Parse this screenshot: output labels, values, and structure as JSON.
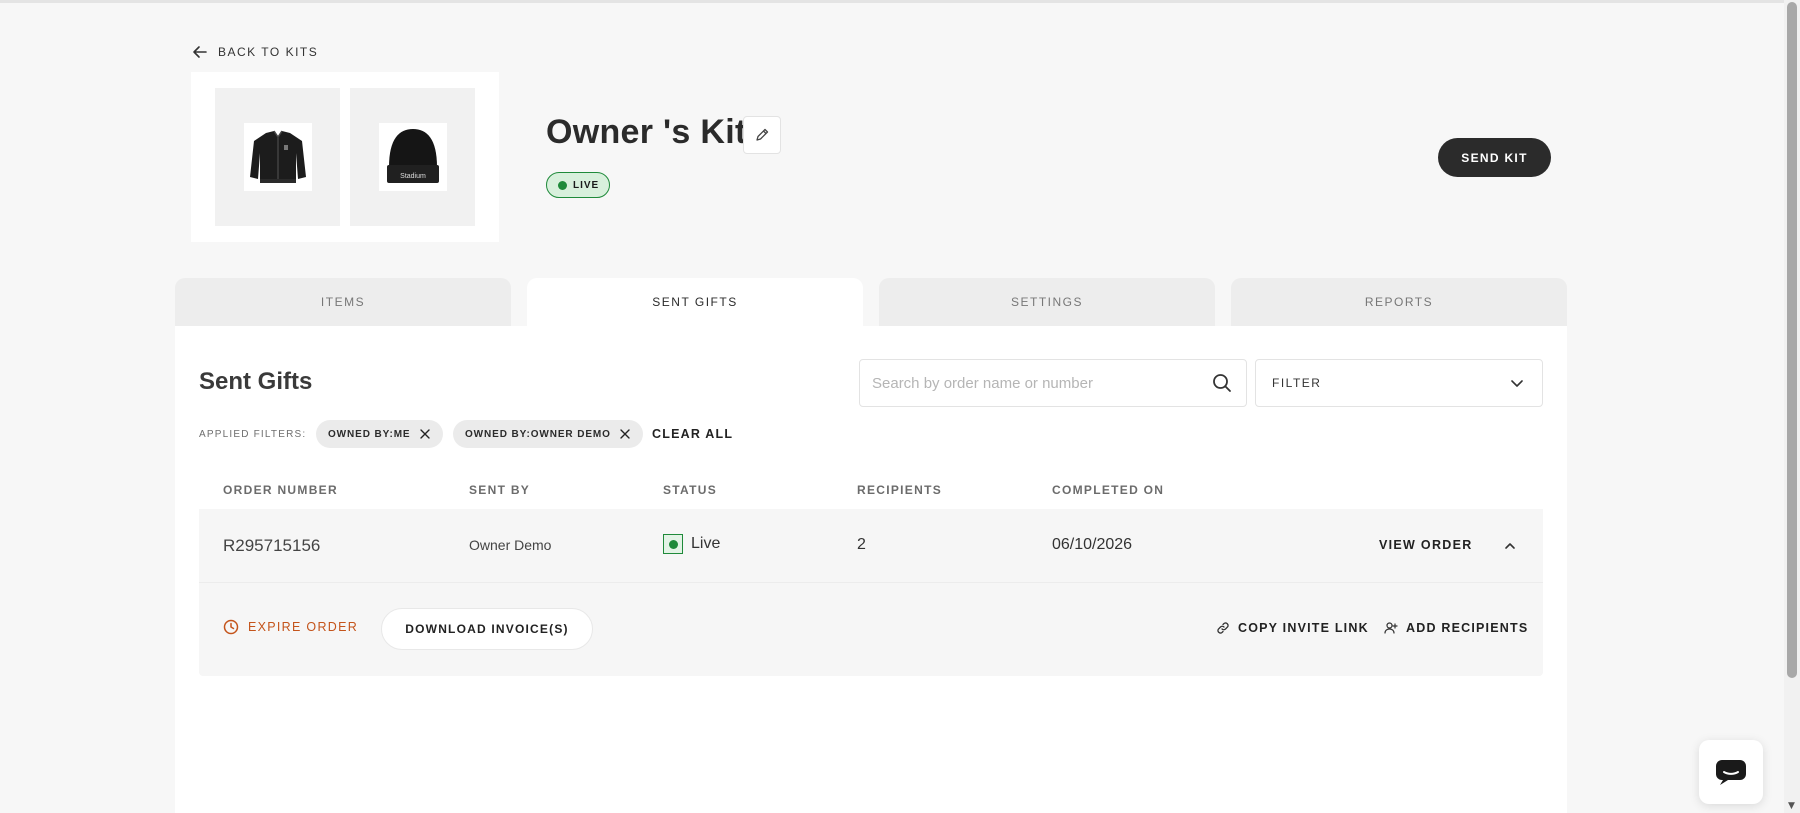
{
  "header": {
    "back_label": "BACK TO KITS",
    "kit_title": "Owner 's Kit",
    "status_badge": "LIVE",
    "send_kit_label": "SEND KIT"
  },
  "kit_images": [
    {
      "alt": "Black bomber jacket"
    },
    {
      "alt": "Black beanie with Stadium logo",
      "logo_text": "Stadium"
    }
  ],
  "tabs": [
    {
      "label": "ITEMS",
      "active": false
    },
    {
      "label": "SENT GIFTS",
      "active": true
    },
    {
      "label": "SETTINGS",
      "active": false
    },
    {
      "label": "REPORTS",
      "active": false
    }
  ],
  "sent_gifts": {
    "title": "Sent Gifts",
    "search_placeholder": "Search by order name or number",
    "search_value": "",
    "filter_label": "FILTER",
    "applied_filters_label": "APPLIED FILTERS:",
    "chips": [
      {
        "label": "OWNED BY:ME"
      },
      {
        "label": "OWNED BY:OWNER DEMO"
      }
    ],
    "clear_all_label": "CLEAR ALL",
    "columns": [
      "ORDER NUMBER",
      "SENT BY",
      "STATUS",
      "RECIPIENTS",
      "COMPLETED ON"
    ],
    "rows": [
      {
        "order_number": "R295715156",
        "sent_by": "Owner Demo",
        "status": "Live",
        "recipients": "2",
        "completed_on": "06/10/2026",
        "view_order_label": "VIEW ORDER",
        "expanded": true
      }
    ],
    "detail_actions": {
      "expire_label": "EXPIRE ORDER",
      "download_label": "DOWNLOAD INVOICE(S)",
      "copy_link_label": "COPY INVITE LINK",
      "add_recipients_label": "ADD RECIPIENTS"
    }
  },
  "colors": {
    "primary_dark": "#2b2b2b",
    "live_green": "#1f8a3a",
    "live_green_bg": "#d8f0dc",
    "expire_orange": "#c4541b",
    "page_bg": "#f7f7f7"
  },
  "icons": {
    "back": "arrow-left-icon",
    "edit": "pencil-icon",
    "search": "search-icon",
    "filter_chevron": "chevron-down-icon",
    "chip_remove": "close-icon",
    "collapse": "chevron-up-icon",
    "expire": "clock-icon",
    "copy_link": "link-icon",
    "add_recipients": "user-plus-icon",
    "chat": "chat-bubble-icon"
  }
}
